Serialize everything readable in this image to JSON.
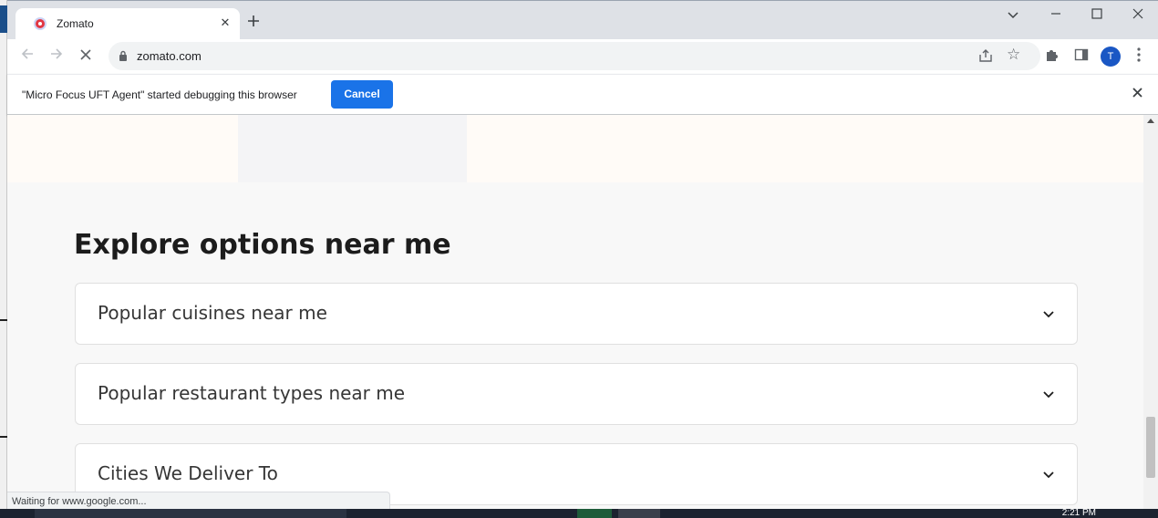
{
  "browser": {
    "tab": {
      "title": "Zomato",
      "favicon": "zomato-favicon"
    },
    "address_bar": {
      "url": "zomato.com"
    },
    "profile_initial": "T",
    "window_controls": {
      "minimize": "—",
      "maximize": "☐",
      "close": "✕",
      "tab_search": "⌄"
    }
  },
  "infobar": {
    "message": "\"Micro Focus UFT Agent\" started debugging this browser",
    "cancel_label": "Cancel"
  },
  "page": {
    "section_title": "Explore options near me",
    "accordions": [
      {
        "label": "Popular cuisines near me"
      },
      {
        "label": "Popular restaurant types near me"
      },
      {
        "label": "Cities We Deliver To"
      }
    ]
  },
  "status_bar": {
    "text": "Waiting for www.google.com..."
  },
  "taskbar": {
    "clock": "2:21 PM"
  },
  "colors": {
    "accent_blue": "#1a73e8",
    "zomato_red": "#e23744",
    "tabstrip": "#dee1e6"
  }
}
